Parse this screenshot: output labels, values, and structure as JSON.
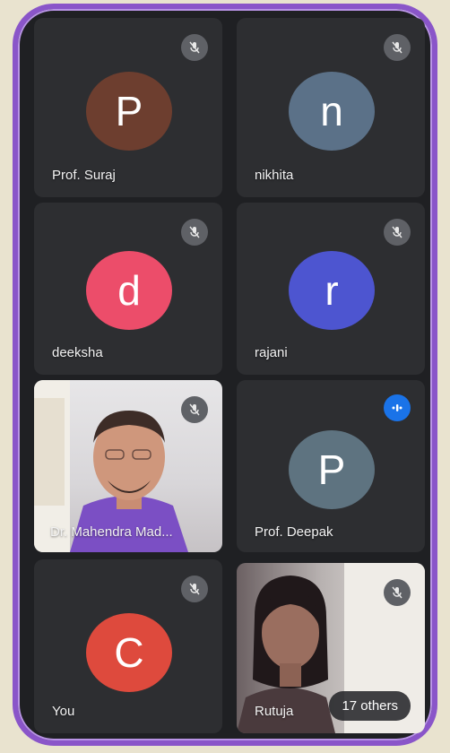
{
  "participants": [
    {
      "name": "Prof. Suraj",
      "initial": "P",
      "color": "#6d3e2f",
      "muted": true
    },
    {
      "name": "nikhita",
      "initial": "n",
      "color": "#5b7188",
      "muted": true
    },
    {
      "name": "deeksha",
      "initial": "d",
      "color": "#ec4d6a",
      "muted": true
    },
    {
      "name": "rajani",
      "initial": "r",
      "color": "#4d55d0",
      "muted": true
    },
    {
      "name": "Dr. Mahendra Mad...",
      "video": true,
      "muted": true
    },
    {
      "name": "Prof. Deepak",
      "initial": "P",
      "color": "#5e7380",
      "muted": false,
      "speaking": true
    },
    {
      "name": "You",
      "initial": "C",
      "color": "#de4a3d",
      "muted": true
    },
    {
      "name": "Rutuja",
      "video": true,
      "muted": true
    }
  ],
  "overflow": {
    "label": "17 others"
  },
  "colors": {
    "frame": "#8a55c9",
    "tile": "#2d2e31",
    "background": "#1f2023"
  }
}
